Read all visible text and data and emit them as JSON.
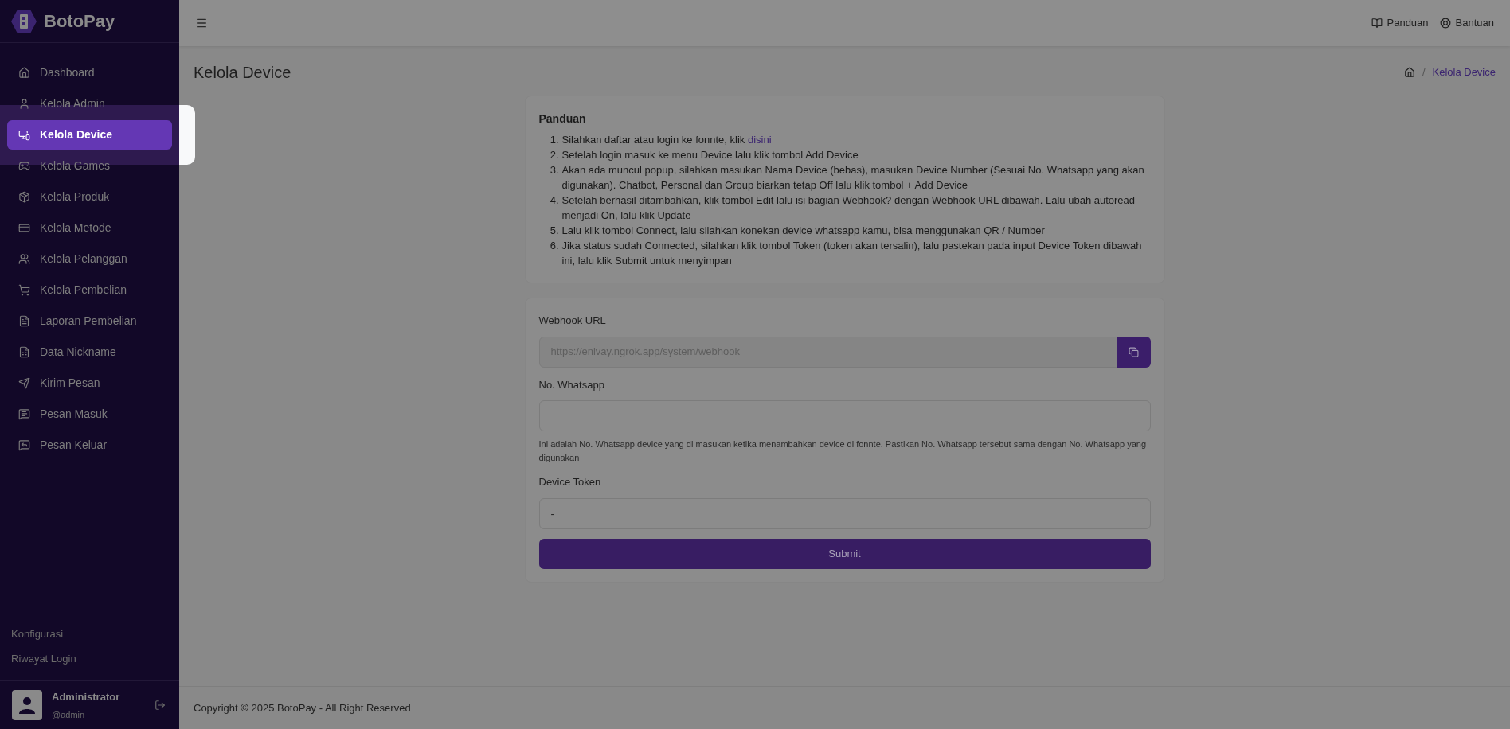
{
  "brand": "BotoPay",
  "sidebar": {
    "items": [
      {
        "label": "Dashboard",
        "selected": false
      },
      {
        "label": "Kelola Admin",
        "selected": false
      },
      {
        "label": "Kelola Device",
        "selected": true
      },
      {
        "label": "Kelola Games",
        "selected": false
      },
      {
        "label": "Kelola Produk",
        "selected": false
      },
      {
        "label": "Kelola Metode",
        "selected": false
      },
      {
        "label": "Kelola Pelanggan",
        "selected": false
      },
      {
        "label": "Kelola Pembelian",
        "selected": false
      },
      {
        "label": "Laporan Pembelian",
        "selected": false
      },
      {
        "label": "Data Nickname",
        "selected": false
      },
      {
        "label": "Kirim Pesan",
        "selected": false
      },
      {
        "label": "Pesan Masuk",
        "selected": false
      },
      {
        "label": "Pesan Keluar",
        "selected": false
      }
    ],
    "footer_links": [
      "Konfigurasi",
      "Riwayat Login"
    ],
    "user": {
      "name": "Administrator",
      "handle": "@admin"
    }
  },
  "header": {
    "links": [
      "Panduan",
      "Bantuan"
    ]
  },
  "page": {
    "title": "Kelola Device",
    "breadcrumb_separator": "/",
    "breadcrumb": "Kelola Device"
  },
  "guide": {
    "title": "Panduan",
    "steps": [
      {
        "number": "1.",
        "text": "Silahkan daftar atau login ke fonnte, klik ",
        "link": "disini"
      },
      {
        "number": "2.",
        "text": "Setelah login masuk ke menu Device lalu klik tombol Add Device"
      },
      {
        "number": "3.",
        "text": "Akan ada muncul popup, silahkan masukan Nama Device (bebas), masukan Device Number (Sesuai No. Whatsapp yang akan digunakan). Chatbot, Personal dan Group biarkan tetap Off lalu klik tombol + Add Device"
      },
      {
        "number": "4.",
        "text": "Setelah berhasil ditambahkan, klik tombol Edit lalu isi bagian Webhook? dengan Webhook URL dibawah. Lalu ubah autoread menjadi On, lalu klik Update"
      },
      {
        "number": "5.",
        "text": "Lalu klik tombol Connect, lalu silahkan konekan device whatsapp kamu, bisa menggunakan QR / Number"
      },
      {
        "number": "6.",
        "text": "Jika status sudah Connected, silahkan klik tombol Token (token akan tersalin), lalu pastekan pada input Device Token dibawah ini, lalu klik Submit untuk menyimpan"
      }
    ]
  },
  "form": {
    "fields": [
      {
        "kind": "copy",
        "label": "Webhook URL",
        "value": "https://enivay.ngrok.app/system/webhook",
        "disabled": true
      },
      {
        "kind": "text",
        "label": "No. Whatsapp",
        "disabled": false,
        "help": "Ini adalah No. Whatsapp device yang di masukan ketika menambahkan device di fonnte. Pastikan No. Whatsapp tersebut sama dengan No. Whatsapp yang digunakan"
      },
      {
        "kind": "text",
        "label": "Device Token",
        "value": "-",
        "disabled": false
      }
    ],
    "submit": "Submit"
  },
  "footer": "Copyright © 2025 BotoPay - All Right Reserved"
}
